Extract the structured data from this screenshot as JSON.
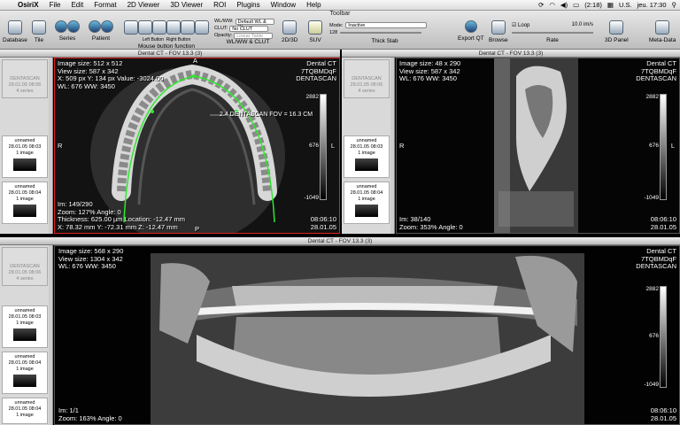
{
  "menubar": {
    "app": "OsiriX",
    "items": [
      "File",
      "Edit",
      "Format",
      "2D Viewer",
      "3D Viewer",
      "ROI",
      "Plugins",
      "Window",
      "Help"
    ],
    "battery": "(2:18)",
    "locale": "U.S.",
    "clock": "jeu. 17:30"
  },
  "toolbar": {
    "title": "Toolbar",
    "database": "Database",
    "tile": "Tile",
    "series": "Series",
    "patient": "Patient",
    "mouse_function": "Mouse button function",
    "left_button": "Left Button",
    "right_button": "Right Button",
    "wlww_label": "WL/WW:",
    "wlww_value": "Default WL & W",
    "clut_label": "CLUT:",
    "clut_value": "No CLUT",
    "opacity_label": "Opacity:",
    "opacity_value": "Linear Table",
    "wlww_clut": "WL/WW & CLUT",
    "twod_threed": "2D/3D",
    "suv": "SUV",
    "mode_label": "Mode:",
    "mode_value": "Inactive",
    "slab_value": "128",
    "thick_slab": "Thick Slab",
    "export_qt": "Export QT",
    "browse": "Browse",
    "loop": "Loop",
    "rate_value": "10.0 im/s",
    "rate": "Rate",
    "panel3d": "3D Panel",
    "metadata": "Meta-Data"
  },
  "windows": {
    "win1_title": "Dental CT - FOV 13.3 (3)",
    "win2_title": "Dental CT - FOV 13.3 (3)",
    "win3_title": "Dental CT - FOV 13.3 (3)"
  },
  "thumbs": {
    "dentascan": "DENTASCAN",
    "date1": "28.01.05 08:06",
    "series4": "4 series",
    "unnamed": "unnamed",
    "date2": "28.01.05 08:03",
    "date3": "28.01.05 08:04",
    "oneimage": "1 image"
  },
  "view1": {
    "tl": [
      "Image size: 512 x 512",
      "View size: 587 x 342",
      "X: 509 px Y: 134 px Value: -3024.00",
      "WL: 676 WW: 3450"
    ],
    "tr": [
      "Dental CT",
      "7TQBMDqF",
      "DENTASCAN"
    ],
    "measure": "2.4 DENTASCAN FOV = 16.3 CM",
    "bl": [
      "Im: 149/290",
      "Zoom: 127% Angle: 0",
      "Thickness: 625.00 µm Location: -12.47 mm",
      "X: 78.32 mm Y: -72.31 mm Z: -12.47 mm"
    ],
    "br": [
      "08:06:10",
      "28.01.05"
    ],
    "cb_top": "2882",
    "cb_mid": "676",
    "cb_bot": "-1049",
    "or_top": "A",
    "or_left": "R",
    "or_right": "L",
    "or_bottom": "P"
  },
  "view2": {
    "tl": [
      "Image size: 48 x 290",
      "View size: 587 x 342",
      "WL: 676 WW: 3450"
    ],
    "tr": [
      "Dental CT",
      "7TQBMDqF",
      "DENTASCAN"
    ],
    "bl": [
      "Im: 38/140",
      "Zoom: 353% Angle: 0"
    ],
    "br": [
      "08:06:10",
      "28.01.05"
    ],
    "cb_top": "2882",
    "cb_mid": "676",
    "cb_bot": "-1049",
    "or_left": "R",
    "or_right": "L"
  },
  "view3": {
    "tl": [
      "Image size: 568 x 290",
      "View size: 1304 x 342",
      "WL: 676 WW: 3450"
    ],
    "tr": [
      "Dental CT",
      "7TQBMDqF",
      "DENTASCAN"
    ],
    "bl": [
      "Im: 1/1",
      "Zoom: 163% Angle: 0"
    ],
    "br": [
      "08:06:10",
      "28.01.05"
    ],
    "cb_top": "2882",
    "cb_mid": "676",
    "cb_bot": "-1049"
  }
}
